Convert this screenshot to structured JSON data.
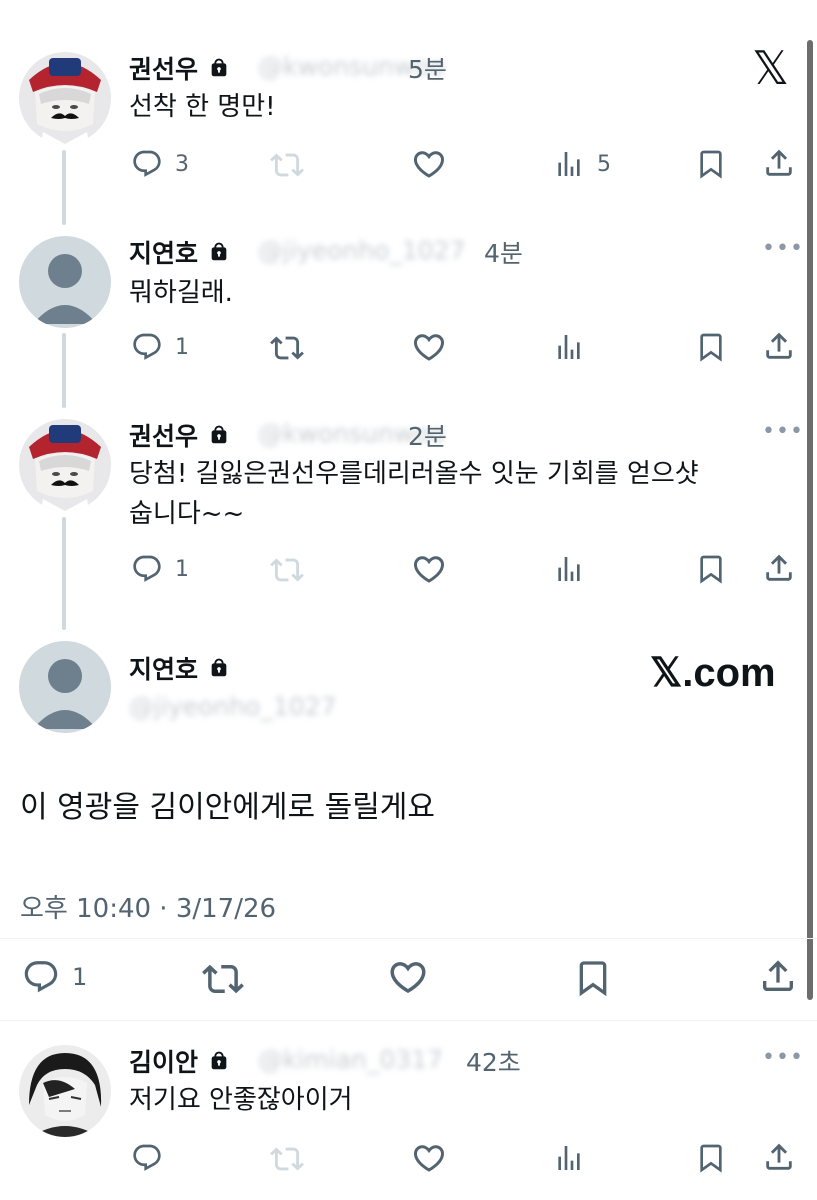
{
  "brand": {
    "logo": "𝕏",
    "watermark": "𝕏.com"
  },
  "thread": [
    {
      "author": "권선우",
      "handle": "@kwonsunwoo",
      "time": "5분",
      "text": "선착 한 명만!",
      "replies": "3",
      "retweets": "",
      "views": "5"
    },
    {
      "author": "지연호",
      "handle": "@jiyeonho_1027",
      "time": "4분",
      "text": "뭐하길래.",
      "replies": "1",
      "retweets": "",
      "views": ""
    },
    {
      "author": "권선우",
      "handle": "@kwonsunwoo",
      "time": "2분",
      "text_line1": "당첨! 길잃은권선우를데리러올수 잇눈 기회를 얻으샷",
      "text_line2": "숩니다~~",
      "replies": "1",
      "retweets": "",
      "views": ""
    }
  ],
  "focused": {
    "author": "지연호",
    "handle": "@jiyeonho_1027",
    "text": "이 영광을 김이안에게로 돌릴게요",
    "timestamp": "오후 10:40 · 3/17/26",
    "replies": "1"
  },
  "reply": {
    "author": "김이안",
    "handle": "@kimian_0317",
    "time": "42초",
    "text": "저기요 안좋잖아이거"
  },
  "colors": {
    "text": "#0f1419",
    "secondary": "#536471",
    "line": "#cfd9de"
  }
}
